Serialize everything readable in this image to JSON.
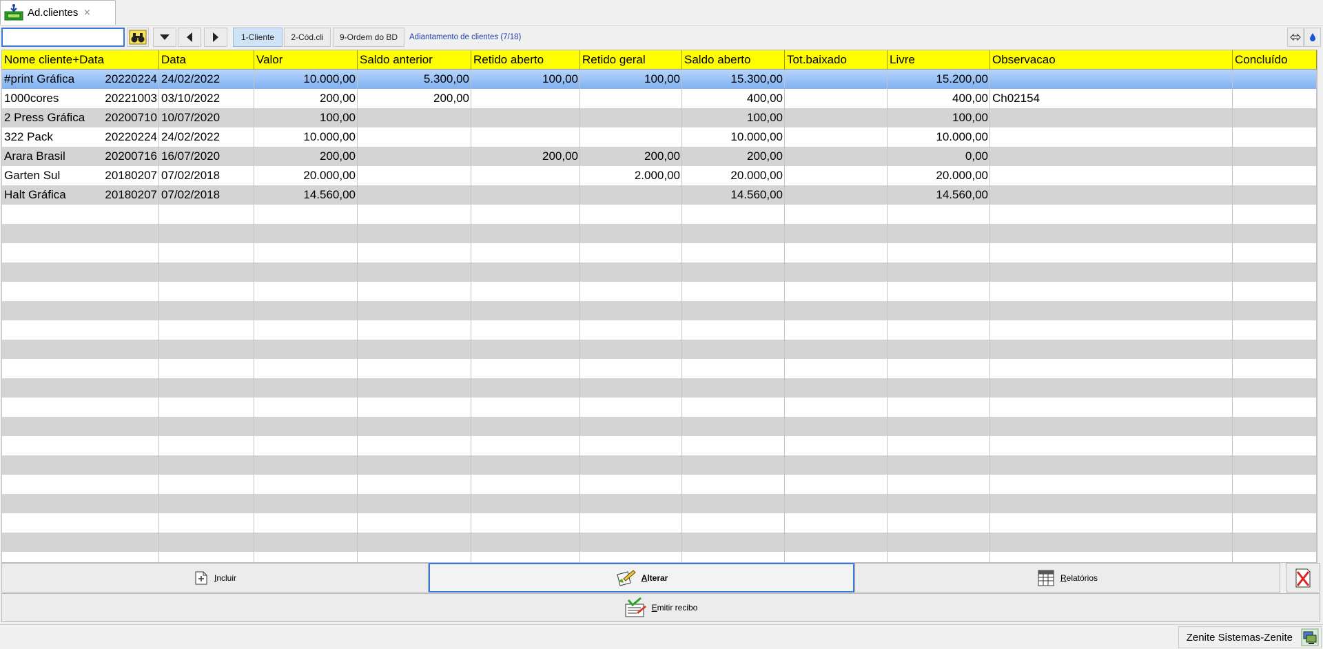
{
  "tab": {
    "label": "Ad.clientes",
    "close": "×"
  },
  "toolbar": {
    "search_value": "",
    "order_tabs": [
      {
        "label": "1-Cliente",
        "active": true
      },
      {
        "label": "2-Cód.cli",
        "active": false
      },
      {
        "label": "9-Ordem do BD",
        "active": false
      }
    ],
    "info": "Adiantamento de clientes (7/18)"
  },
  "grid": {
    "columns": [
      "Nome cliente+Data",
      "Data",
      "Valor",
      "Saldo anterior",
      "Retido aberto",
      "Retido geral",
      "Saldo aberto",
      "Tot.baixado",
      "Livre",
      "Observacao",
      "Concluído"
    ],
    "rows": [
      {
        "name": "#print Gráfica",
        "code": "20220224",
        "data": "24/02/2022",
        "valor": "10.000,00",
        "saldo_anterior": "5.300,00",
        "retido_aberto": "100,00",
        "retido_geral": "100,00",
        "saldo_aberto": "15.300,00",
        "tot_baixado": "",
        "livre": "15.200,00",
        "observacao": "",
        "concluido": ""
      },
      {
        "name": "1000cores",
        "code": "20221003",
        "data": "03/10/2022",
        "valor": "200,00",
        "saldo_anterior": "200,00",
        "retido_aberto": "",
        "retido_geral": "",
        "saldo_aberto": "400,00",
        "tot_baixado": "",
        "livre": "400,00",
        "observacao": "Ch02154",
        "concluido": ""
      },
      {
        "name": "2 Press Gráfica",
        "code": "20200710",
        "data": "10/07/2020",
        "valor": "100,00",
        "saldo_anterior": "",
        "retido_aberto": "",
        "retido_geral": "",
        "saldo_aberto": "100,00",
        "tot_baixado": "",
        "livre": "100,00",
        "observacao": "",
        "concluido": ""
      },
      {
        "name": "322 Pack",
        "code": "20220224",
        "data": "24/02/2022",
        "valor": "10.000,00",
        "saldo_anterior": "",
        "retido_aberto": "",
        "retido_geral": "",
        "saldo_aberto": "10.000,00",
        "tot_baixado": "",
        "livre": "10.000,00",
        "observacao": "",
        "concluido": ""
      },
      {
        "name": "Arara Brasil",
        "code": "20200716",
        "data": "16/07/2020",
        "valor": "200,00",
        "saldo_anterior": "",
        "retido_aberto": "200,00",
        "retido_geral": "200,00",
        "saldo_aberto": "200,00",
        "tot_baixado": "",
        "livre": "0,00",
        "observacao": "",
        "concluido": ""
      },
      {
        "name": "Garten Sul",
        "code": "20180207",
        "data": "07/02/2018",
        "valor": "20.000,00",
        "saldo_anterior": "",
        "retido_aberto": "",
        "retido_geral": "2.000,00",
        "saldo_aberto": "20.000,00",
        "tot_baixado": "",
        "livre": "20.000,00",
        "observacao": "",
        "concluido": ""
      },
      {
        "name": "Halt Gráfica",
        "code": "20180207",
        "data": "07/02/2018",
        "valor": "14.560,00",
        "saldo_anterior": "",
        "retido_aberto": "",
        "retido_geral": "",
        "saldo_aberto": "14.560,00",
        "tot_baixado": "",
        "livre": "14.560,00",
        "observacao": "",
        "concluido": ""
      }
    ],
    "empty_rows": 19,
    "colors": {
      "header": "#ffff00",
      "stripe": "#d4d4d4",
      "selected": "#7fb1f1"
    }
  },
  "buttons": {
    "incluir": "Incluir",
    "alterar": "Alterar",
    "relatorios": "Relatórios",
    "emitir_recibo": "Emitir recibo"
  },
  "status": {
    "text": "Zenite Sistemas-Zenite"
  }
}
